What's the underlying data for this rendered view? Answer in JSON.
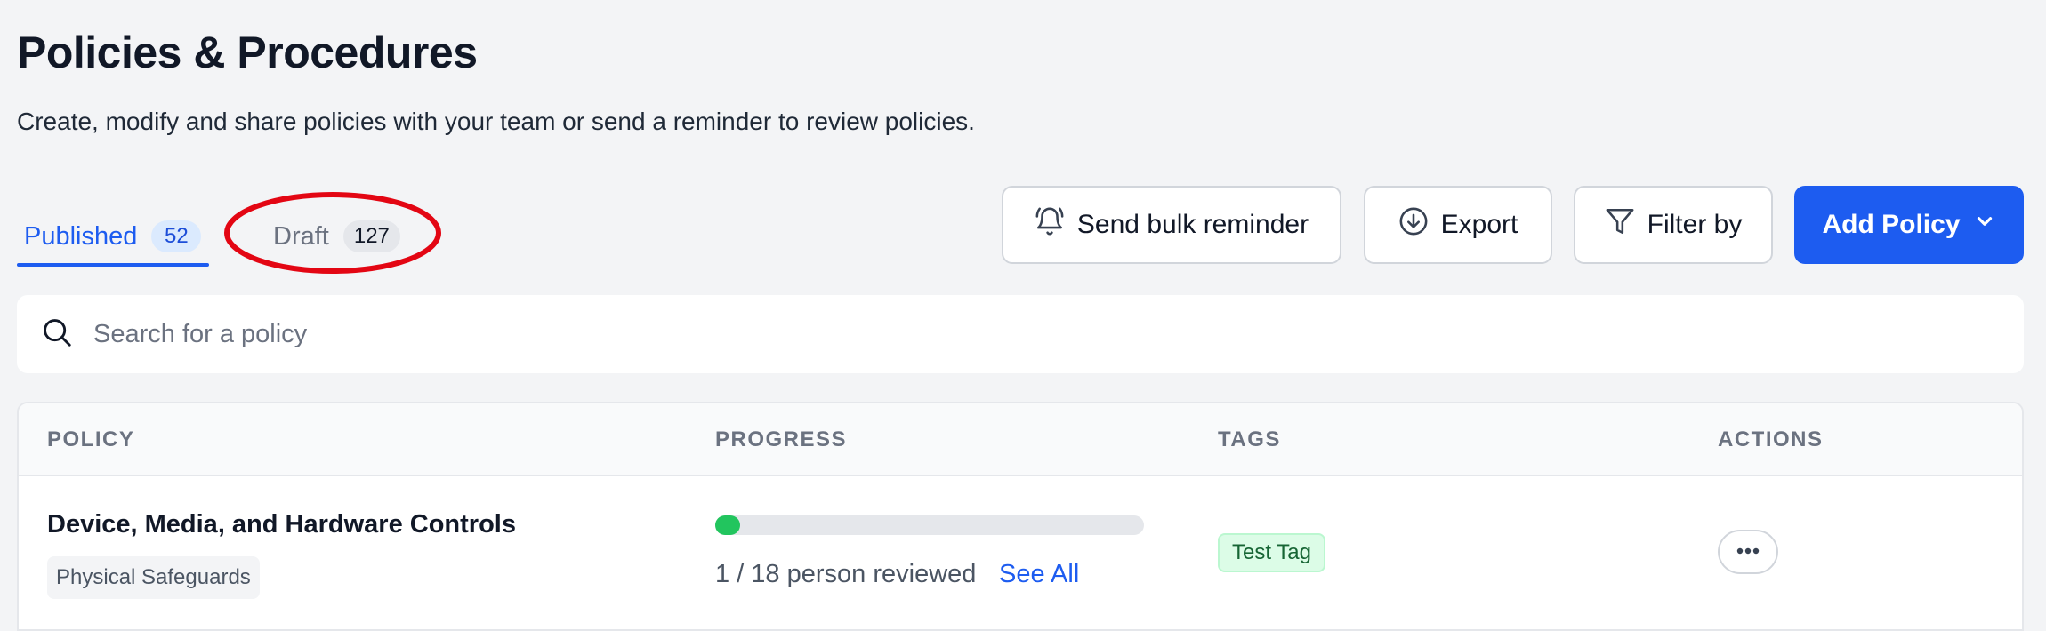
{
  "header": {
    "title": "Policies & Procedures",
    "subtitle": "Create, modify and share policies with your team or send a reminder to review policies."
  },
  "tabs": [
    {
      "label": "Published",
      "count": "52",
      "active": true
    },
    {
      "label": "Draft",
      "count": "127",
      "active": false
    }
  ],
  "toolbar": {
    "bulk_reminder_label": "Send bulk reminder",
    "export_label": "Export",
    "filter_label": "Filter by",
    "add_policy_label": "Add Policy"
  },
  "search": {
    "placeholder": "Search for a policy",
    "value": ""
  },
  "table": {
    "columns": [
      "POLICY",
      "PROGRESS",
      "TAGS",
      "ACTIONS"
    ],
    "rows": [
      {
        "policy": "Device, Media, and Hardware Controls",
        "category": "Physical Safeguards",
        "progress_fraction": 0.0556,
        "progress_text": "1 / 18 person reviewed",
        "progress_link": "See All",
        "tag": "Test Tag"
      }
    ]
  },
  "colors": {
    "accent": "#1d5cf0",
    "progress": "#22c55e",
    "tag_bg": "#dcfce7",
    "tag_text": "#166534",
    "annotation": "#e30613"
  },
  "icons": {
    "bell": "bell-icon",
    "export": "download-circle-icon",
    "filter": "funnel-icon",
    "chevron": "chevron-down-icon",
    "search": "search-icon",
    "more": "more-horizontal-icon"
  }
}
